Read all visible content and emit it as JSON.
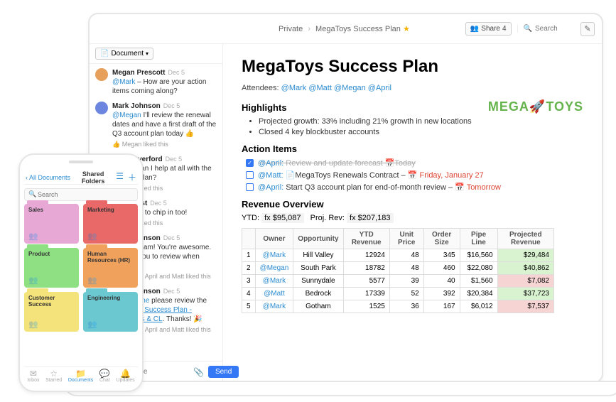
{
  "breadcrumb": {
    "root": "Private",
    "doc": "MegaToys Success Plan"
  },
  "header": {
    "share_label": "Share",
    "share_count": "4",
    "search_placeholder": "Search"
  },
  "chat": {
    "dropdown_label": "Document",
    "compose_placeholder": "Type a message",
    "send_label": "Send",
    "messages": [
      {
        "av": "av1",
        "name": "Megan Prescott",
        "date": "Dec 5",
        "body_pre": "",
        "mention": "@Mark",
        "body_post": " – How are your action items coming along?",
        "reaction": ""
      },
      {
        "av": "av2",
        "name": "Mark Johnson",
        "date": "Dec 5",
        "body_pre": "",
        "mention": "@Megan",
        "body_post": " I'll review the renewal dates and have a first draft of the Q3 account plan today 👍",
        "reaction": "👍 Megan liked this"
      },
      {
        "av": "av3",
        "name": "Matt Haverford",
        "date": "Dec 5",
        "body_pre": "",
        "mention": "@Mark",
        "body_post": " can I help at all with the account plan?",
        "reaction": "👍 Mark liked this"
      },
      {
        "av": "av4",
        "name": "April West",
        "date": "Dec 5",
        "body_pre": "I'm happy to chip in too!",
        "mention": "",
        "body_post": "",
        "reaction": "👍 Mark liked this"
      },
      {
        "av": "av2",
        "name": "Mark Johnson",
        "date": "Dec 5",
        "body_pre": "Thanks team! You're awesome. Will ask you to review when ready. 💯",
        "mention": "",
        "body_post": "",
        "reaction": "👍 Megan, April and Matt liked this"
      },
      {
        "av": "av2",
        "name": "Mark Johnson",
        "date": "Dec 5",
        "body_pre": "",
        "mention": "@Everyone",
        "body_post": " please review the ",
        "link": "Mutual Success Plan - MegaToys & CL",
        "body_after_link": ". Thanks! 🎉",
        "reaction": "👍 Megan, April and Matt liked this"
      }
    ]
  },
  "page": {
    "title": "MegaToys Success Plan",
    "attendees_label": "Attendees:",
    "attendees_people": "@Mark @Matt @Megan @April",
    "brand_a": "MEGA",
    "brand_rocket": "🚀",
    "brand_b": "TOYS",
    "sections": {
      "highlights_heading": "Highlights",
      "highlights_bullets": [
        "Projected growth: 33% including 21% growth in new locations",
        "Closed 4 key blockbuster accounts"
      ],
      "actions_heading": "Action Items",
      "action_items": [
        {
          "done": true,
          "who": "@April:",
          "text": " Review and update forecast 📅Today",
          "strike": true,
          "flag": ""
        },
        {
          "done": false,
          "who": "@Matt:",
          "text": " 📄MegaToys Renewals Contract – ",
          "flag": "📅 Friday, January 27"
        },
        {
          "done": false,
          "who": "@April:",
          "text": " Start Q3 account plan for end-of-month review – ",
          "flag": "📅 Tomorrow"
        }
      ],
      "revenue_heading": "Revenue Overview",
      "ytd_label": "YTD:",
      "ytd_val": "fx $95,087",
      "proj_label": "Proj. Rev:",
      "proj_val": "fx $207,183",
      "table_headers": [
        "",
        "Owner",
        "Opportunity",
        "YTD Revenue",
        "Unit Price",
        "Order Size",
        "Pipe Line",
        "Projected Revenue"
      ],
      "table_rows": [
        {
          "n": "1",
          "owner": "@Mark",
          "opp": "Hill Valley",
          "ytd": "12924",
          "unit": "48",
          "ord": "345",
          "pipe": "$16,560",
          "proj": "$29,484",
          "cls": "proj-green"
        },
        {
          "n": "2",
          "owner": "@Megan",
          "opp": "South Park",
          "ytd": "18782",
          "unit": "48",
          "ord": "460",
          "pipe": "$22,080",
          "proj": "$40,862",
          "cls": "proj-green"
        },
        {
          "n": "3",
          "owner": "@Mark",
          "opp": "Sunnydale",
          "ytd": "5577",
          "unit": "39",
          "ord": "40",
          "pipe": "$1,560",
          "proj": "$7,082",
          "cls": "proj-red"
        },
        {
          "n": "4",
          "owner": "@Matt",
          "opp": "Bedrock",
          "ytd": "17339",
          "unit": "52",
          "ord": "392",
          "pipe": "$20,384",
          "proj": "$37,723",
          "cls": "proj-green"
        },
        {
          "n": "5",
          "owner": "@Mark",
          "opp": "Gotham",
          "ytd": "1525",
          "unit": "36",
          "ord": "167",
          "pipe": "$6,012",
          "proj": "$7,537",
          "cls": "proj-red"
        }
      ]
    }
  },
  "phone": {
    "back_label": "All Documents",
    "title": "Shared Folders",
    "search_placeholder": "Search",
    "folders": [
      {
        "cls": "f-sales",
        "label": "Sales"
      },
      {
        "cls": "f-mkt",
        "label": "Marketing"
      },
      {
        "cls": "f-prod",
        "label": "Product"
      },
      {
        "cls": "f-hr",
        "label": "Human Resources (HR)"
      },
      {
        "cls": "f-cs",
        "label": "Customer Success"
      },
      {
        "cls": "f-eng",
        "label": "Engineering"
      }
    ],
    "tabs": [
      {
        "icon": "✉",
        "label": "Inbox"
      },
      {
        "icon": "☆",
        "label": "Starred"
      },
      {
        "icon": "📁",
        "label": "Documents",
        "active": true
      },
      {
        "icon": "💬",
        "label": "Chat"
      },
      {
        "icon": "🔔",
        "label": "Updates"
      }
    ]
  }
}
